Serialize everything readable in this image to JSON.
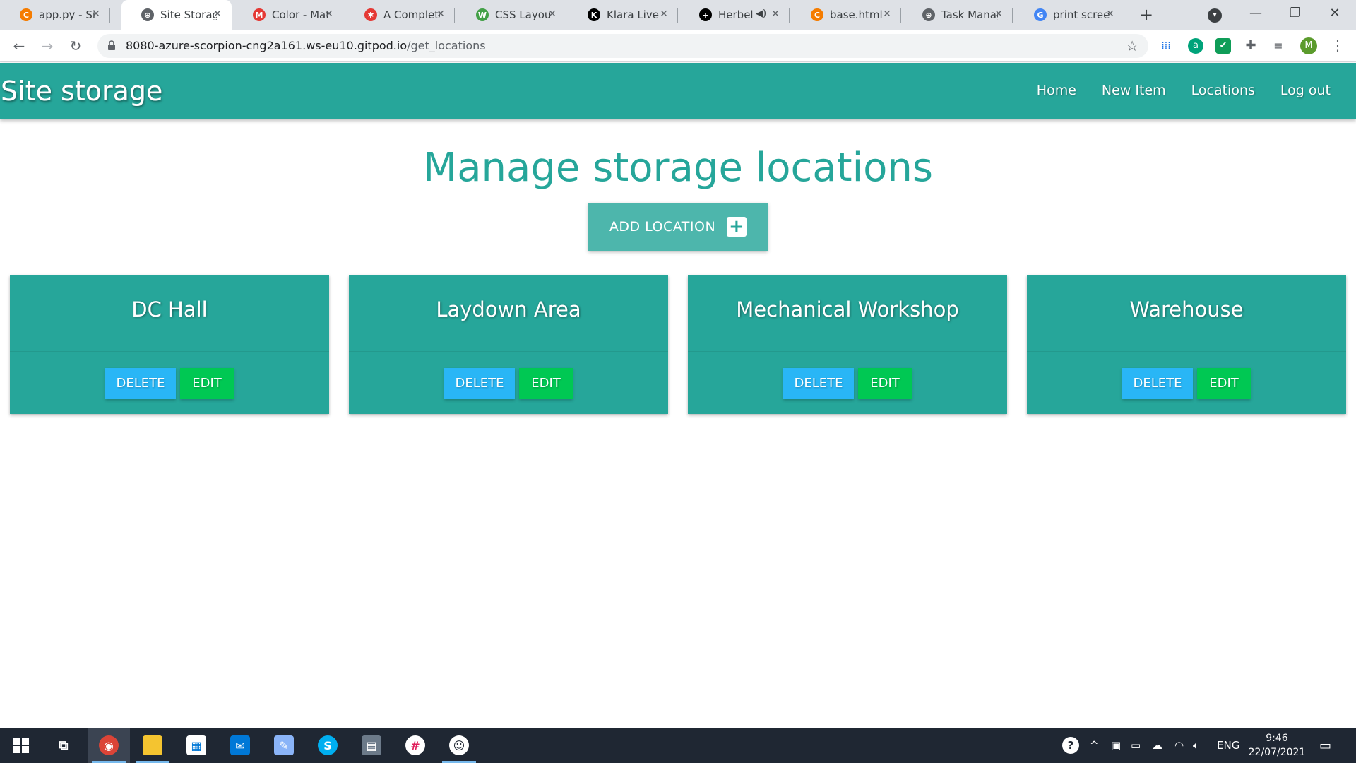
{
  "browser": {
    "tabs": [
      {
        "title": "app.py - Site",
        "favicon_color": "#f57c00",
        "favicon": "C"
      },
      {
        "title": "Site Storage",
        "favicon_color": "#5f6368",
        "favicon": "⊕",
        "active": true
      },
      {
        "title": "Color - Mat",
        "favicon_color": "#e53935",
        "favicon": "M"
      },
      {
        "title": "A Complete",
        "favicon_color": "#e53935",
        "favicon": "✱"
      },
      {
        "title": "CSS Layout",
        "favicon_color": "#43a047",
        "favicon": "W"
      },
      {
        "title": "Klara Live | I",
        "favicon_color": "#000000",
        "favicon": "K"
      },
      {
        "title": "Herbelu",
        "favicon_color": "#000000",
        "favicon": "+"
      },
      {
        "title": "base.html -",
        "favicon_color": "#f57c00",
        "favicon": "C"
      },
      {
        "title": "Task Manag",
        "favicon_color": "#5f6368",
        "favicon": "⊕"
      },
      {
        "title": "print screen",
        "favicon_color": "#4285f4",
        "favicon": "G"
      }
    ],
    "close_glyph": "✕",
    "new_tab_glyph": "+",
    "window_controls": {
      "minimize": "—",
      "restore": "❐",
      "close": "✕"
    },
    "url_host": "8080-azure-scorpion-cng2a161.ws-eu10.gitpod.io",
    "url_path": "/get_locations",
    "profile_initial": "M"
  },
  "site": {
    "brand": "Site storage",
    "nav": [
      "Home",
      "New Item",
      "Locations",
      "Log out"
    ],
    "page_title": "Manage storage locations",
    "add_button_label": "ADD LOCATION",
    "add_button_icon": "+",
    "delete_label": "DELETE",
    "edit_label": "EDIT",
    "locations": [
      "DC Hall",
      "Laydown Area",
      "Mechanical Workshop",
      "Warehouse"
    ],
    "colors": {
      "primary": "#26a69a",
      "primary_light": "#4db6ac",
      "delete_blue": "#29b6f6",
      "edit_green": "#00c853"
    }
  },
  "taskbar": {
    "language": "ENG",
    "time": "9:46",
    "date": "22/07/2021"
  }
}
